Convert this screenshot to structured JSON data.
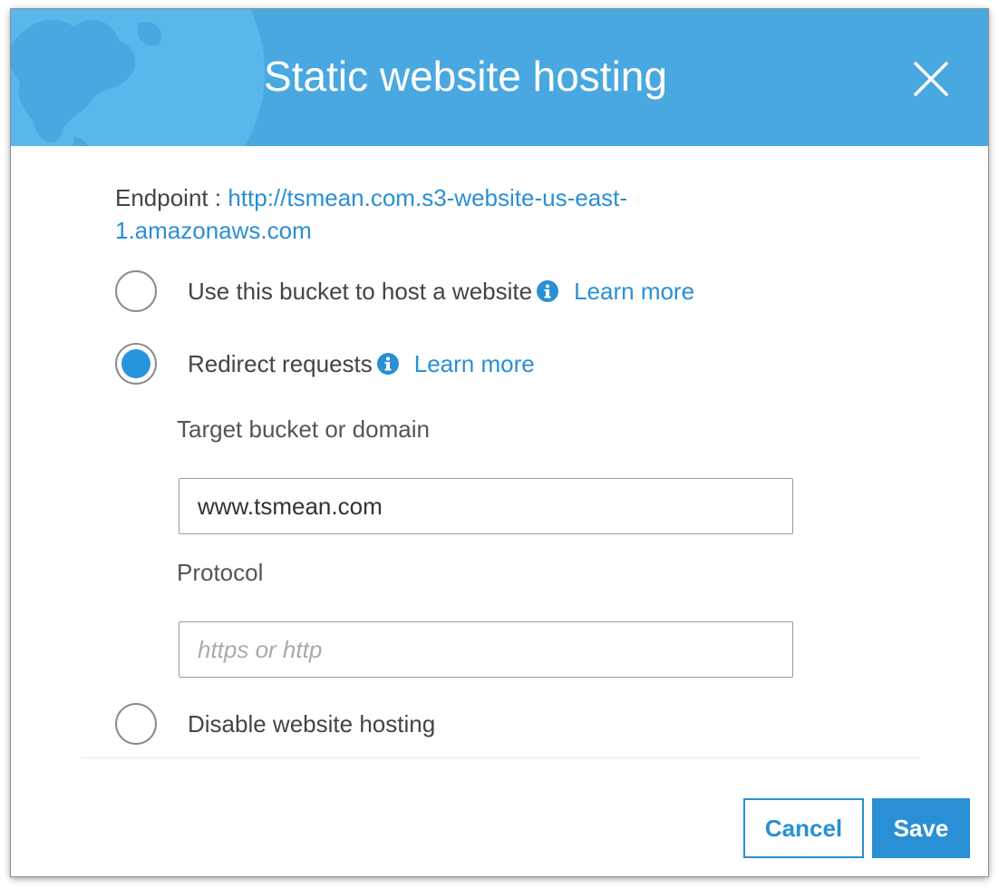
{
  "dialog": {
    "title": "Static website hosting",
    "close_icon": "close-icon",
    "header_color": "#4aa8e0"
  },
  "endpoint": {
    "label": "Endpoint :",
    "url": "http://tsmean.com.s3-website-us-east-1.amazonaws.com"
  },
  "options": {
    "host_website": {
      "label": "Use this bucket to host a website",
      "learn_more": "Learn more",
      "selected": false
    },
    "redirect": {
      "label": "Redirect requests",
      "learn_more": "Learn more",
      "selected": true
    },
    "disable": {
      "label": "Disable website hosting",
      "selected": false
    }
  },
  "redirect_form": {
    "target_label": "Target bucket or domain",
    "target_value": "www.tsmean.com",
    "protocol_label": "Protocol",
    "protocol_value": "",
    "protocol_placeholder": "https or http"
  },
  "footer": {
    "cancel_label": "Cancel",
    "save_label": "Save"
  },
  "colors": {
    "accent": "#2a8fd4",
    "text": "#444444"
  }
}
